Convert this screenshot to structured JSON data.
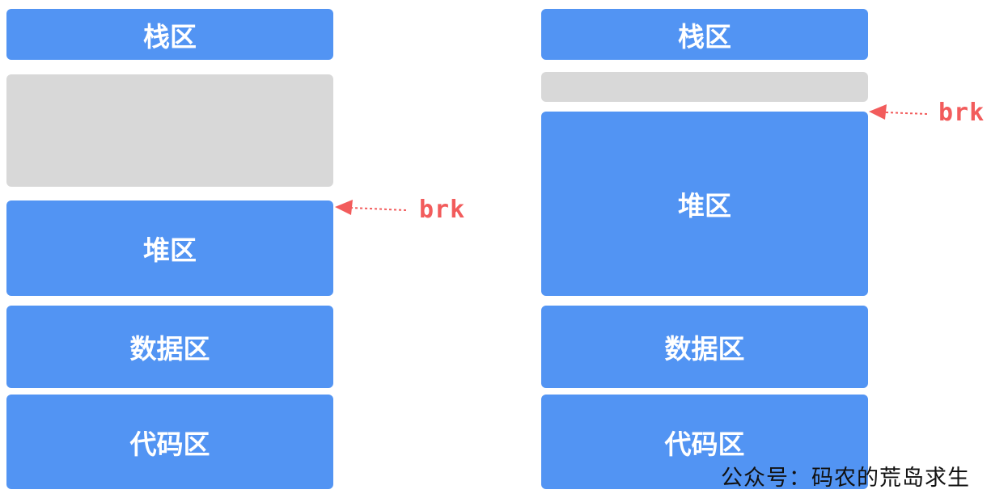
{
  "left_diagram": {
    "stack": "栈区",
    "heap": "堆区",
    "data": "数据区",
    "code": "代码区",
    "pointer": "brk"
  },
  "right_diagram": {
    "stack": "栈区",
    "heap": "堆区",
    "data": "数据区",
    "code": "代码区",
    "pointer": "brk"
  },
  "watermark": "公众号：码农的荒岛求生",
  "colors": {
    "segment": "#5294f3",
    "free": "#d8d8d8",
    "pointer": "#f25c5c"
  }
}
